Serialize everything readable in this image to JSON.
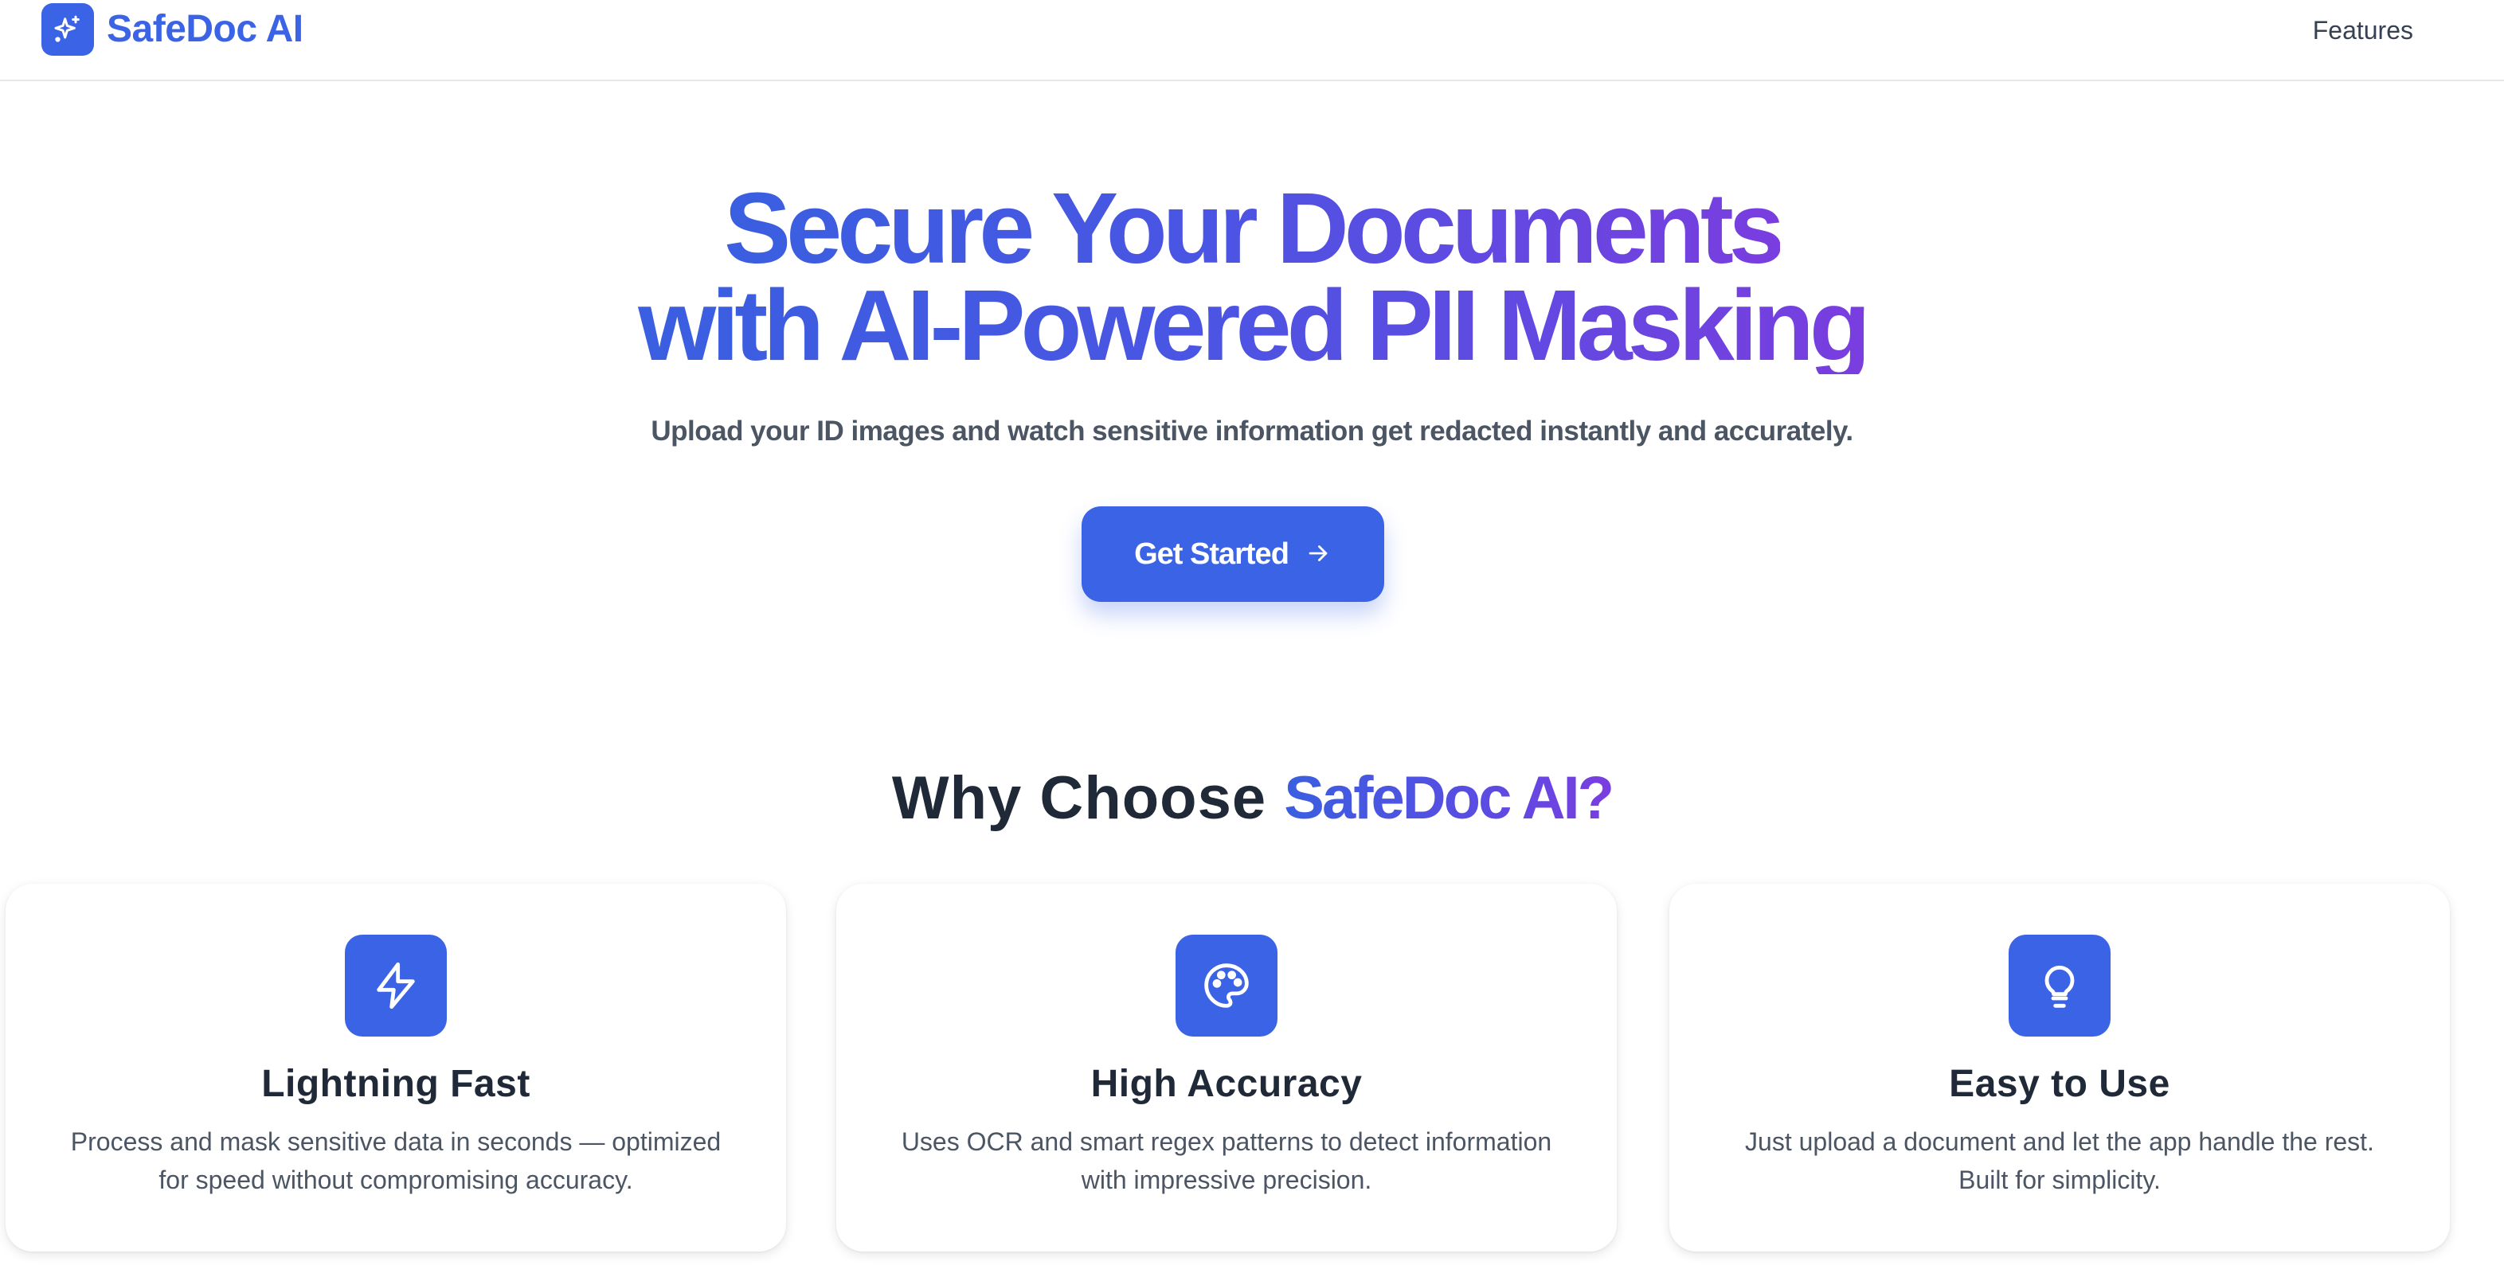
{
  "header": {
    "brand_name": "SafeDoc AI",
    "brand_icon": "sparkles-icon",
    "nav": {
      "features_label": "Features"
    }
  },
  "hero": {
    "title_line1": "Secure Your Documents",
    "title_line2": "with AI-Powered PII Masking",
    "subtitle": "Upload your ID images and watch sensitive information get redacted instantly and accurately.",
    "cta_label": "Get Started",
    "cta_icon": "arrow-right-icon"
  },
  "why": {
    "title_prefix": "Why Choose ",
    "title_accent": "SafeDoc AI?",
    "cards": [
      {
        "icon": "lightning-bolt-icon",
        "title": "Lightning Fast",
        "description": "Process and mask sensitive data in seconds — optimized for speed without compromising accuracy."
      },
      {
        "icon": "palette-icon",
        "title": "High Accuracy",
        "description": "Uses OCR and smart regex patterns to detect information with impressive precision."
      },
      {
        "icon": "lightbulb-icon",
        "title": "Easy to Use",
        "description": "Just upload a document and let the app handle the rest. Built for simplicity."
      }
    ]
  },
  "colors": {
    "primary": "#3a63e6",
    "gradient_start": "#3a5fe0",
    "gradient_end": "#7a3ddf",
    "text_dark": "#1f2937",
    "text_muted": "#4b5563"
  }
}
